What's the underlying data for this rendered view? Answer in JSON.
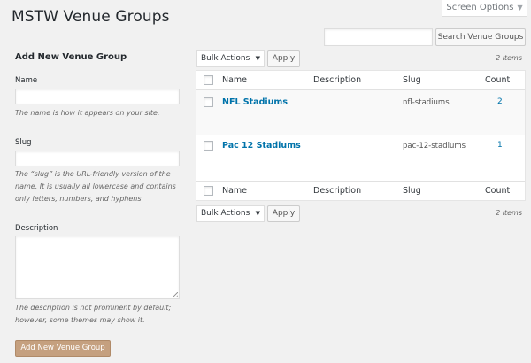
{
  "screen_options": {
    "label": "Screen Options",
    "arrow": "▼"
  },
  "page_title": "MSTW Venue Groups",
  "search": {
    "value": "",
    "button_label": "Search Venue Groups"
  },
  "form": {
    "title": "Add New Venue Group",
    "name_label": "Name",
    "name_value": "",
    "name_help": "The name is how it appears on your site.",
    "slug_label": "Slug",
    "slug_value": "",
    "slug_help": "The “slug” is the URL-friendly version of the name. It is usually all lowercase and contains only letters, numbers, and hyphens.",
    "description_label": "Description",
    "description_value": "",
    "description_help": "The description is not prominent by default; however, some themes may show it.",
    "submit_label": "Add New Venue Group"
  },
  "bulk": {
    "selected": "Bulk Actions",
    "apply_label": "Apply",
    "items_count": "2 items"
  },
  "table": {
    "columns": {
      "name": "Name",
      "description": "Description",
      "slug": "Slug",
      "count": "Count"
    },
    "rows": [
      {
        "name": "NFL Stadiums",
        "description": "",
        "slug": "nfl-stadiums",
        "count": "2"
      },
      {
        "name": "Pac 12 Stadiums",
        "description": "",
        "slug": "pac-12-stadiums",
        "count": "1"
      }
    ]
  },
  "colors": {
    "link": "#0073aa",
    "primary_button": "#c5a07f",
    "background": "#f1f1f1"
  }
}
